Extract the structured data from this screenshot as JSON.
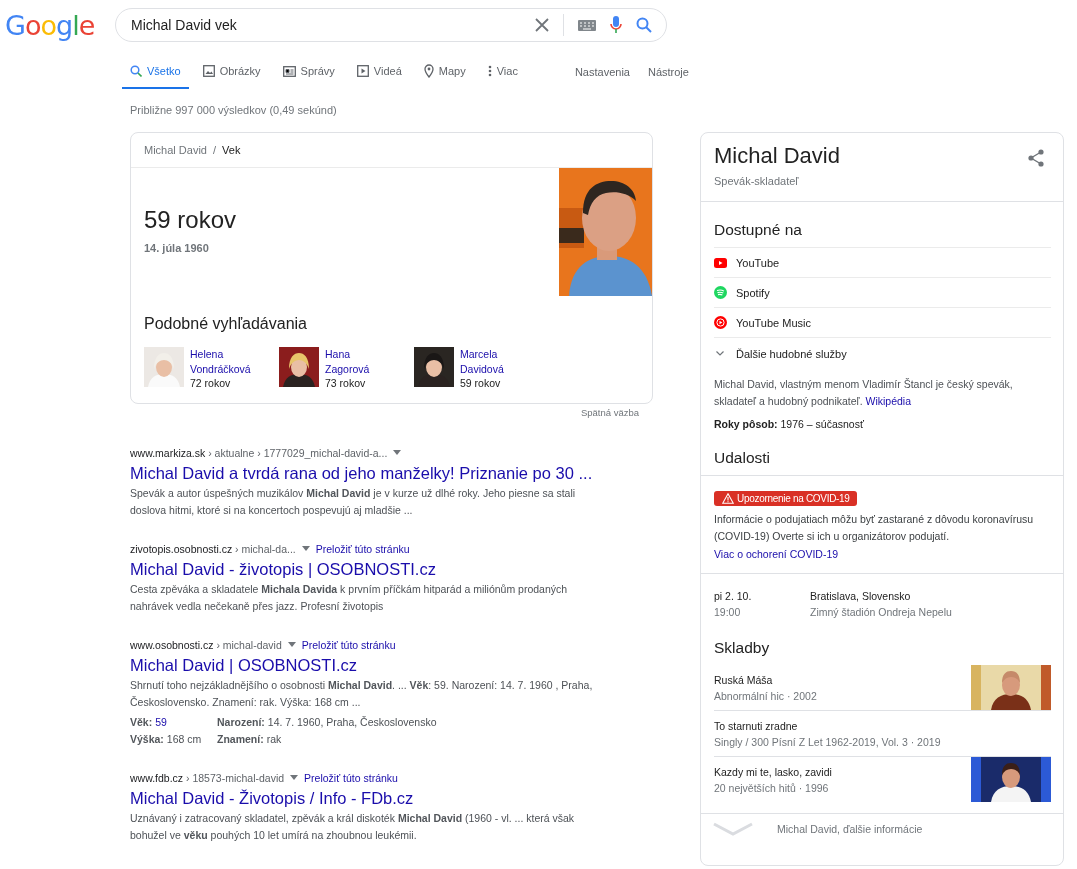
{
  "logo": "Google",
  "search": {
    "value": "Michal David vek"
  },
  "tabs": [
    {
      "label": "Všetko",
      "kind": "search",
      "selected": true
    },
    {
      "label": "Obrázky",
      "kind": "images",
      "selected": false
    },
    {
      "label": "Správy",
      "kind": "news",
      "selected": false
    },
    {
      "label": "Videá",
      "kind": "video",
      "selected": false
    },
    {
      "label": "Mapy",
      "kind": "maps",
      "selected": false
    },
    {
      "label": "Viac",
      "kind": "more",
      "selected": false
    }
  ],
  "tools": [
    "Nastavenia",
    "Nástroje"
  ],
  "result_stats": "Približne 997 000 výsledkov (0,49 sekúnd)",
  "age_card": {
    "breadcrumb": [
      "Michal David",
      "Vek"
    ],
    "breadcrumb_separator": "/",
    "age": "59 rokov",
    "birth_date": "14. júla 1960",
    "similar_title": "Podobné vyhľadávania",
    "similar": [
      {
        "name": "Helena Vondráčková",
        "age": "72 rokov"
      },
      {
        "name": "Hana Zagorová",
        "age": "73 rokov"
      },
      {
        "name": "Marcela Davidová",
        "age": "59 rokov"
      }
    ],
    "feedback": "Spätná väzba"
  },
  "results": [
    {
      "domain": "www.markiza.sk",
      "path": "› aktualne › 1777029_michal-david-a...",
      "title": "Michal David a tvrdá rana od jeho manželky! Priznanie po 30 ...",
      "snippet": "Spevák a autor úspešných muzikálov **Michal David** je v kurze už dlhé roky. Jeho piesne sa stali doslova hitmi, ktoré si na koncertoch pospevujú aj mladšie ..."
    },
    {
      "domain": "zivotopis.osobnosti.cz",
      "path": "› michal-da...",
      "translate": "Preložiť túto stránku",
      "title": "Michal David - životopis | OSOBNOSTI.cz",
      "snippet": "Cesta zpěváka a skladatele **Michala Davida** k prvním příčkám hitparád a miliónům prodaných nahrávek vedla nečekaně přes jazz. Profesní životopis"
    },
    {
      "domain": "www.osobnosti.cz",
      "path": "› michal-david",
      "translate": "Preložiť túto stránku",
      "title": "Michal David | OSOBNOSTI.cz",
      "snippet": "Shrnutí toho nejzákladnějšího o osobnosti **Michal David**. ... **Věk**: 59. Narození: 14. 7. 1960 , Praha, Československo. Znamení: rak. Výška: 168 cm ...",
      "facts": [
        {
          "label": "Věk:",
          "value": "59",
          "link": true
        },
        {
          "label": "Narození:",
          "value": "14. 7. 1960, Praha, Československo",
          "link": false
        },
        {
          "label": "Výška:",
          "value": "168 cm",
          "link": false
        },
        {
          "label": "Znamení:",
          "value": "rak",
          "link": false
        }
      ]
    },
    {
      "domain": "www.fdb.cz",
      "path": "› 18573-michal-david",
      "translate": "Preložiť túto stránku",
      "title": "Michal David - Životopis / Info - FDb.cz",
      "snippet": "Uznávaný i zatracovaný skladatel, zpěvák a král diskoték **Michal David** (1960 - vl. ... která však bohužel ve **věku** pouhých 10 let umírá na zhoubnou leukémii."
    }
  ],
  "panel": {
    "title": "Michal David",
    "subtitle": "Spevák-skladateľ",
    "available_title": "Dostupné na",
    "services": [
      {
        "name": "YouTube",
        "kind": "youtube"
      },
      {
        "name": "Spotify",
        "kind": "spotify"
      },
      {
        "name": "YouTube Music",
        "kind": "ytmusic"
      }
    ],
    "more_services": "Ďalšie hudobné služby",
    "description": "Michal David, vlastným menom Vladimír Štancl je český spevák, skladateľ a hudobný podnikateľ.",
    "description_link": "Wikipédia",
    "active_years": "**Roky pôsob:** 1976 – súčasnosť",
    "events_title": "Udalosti",
    "covid_badge": "Upozornenie na COVID-19",
    "covid_text": "Informácie o podujatiach môžu byť zastarané z dôvodu koronavírusu (COVID-19) Overte si ich u organizátorov podujatí.",
    "covid_link": "Viac o ochorení COVID-19",
    "event": {
      "date": "pi 2. 10.",
      "time": "19:00",
      "city": "Bratislava, Slovensko",
      "venue": "Zimný štadión Ondreja Nepelu"
    },
    "songs_title": "Skladby",
    "songs": [
      {
        "title": "Ruská Máša",
        "meta": "Abnormální hic · 2002",
        "kind": "picture"
      },
      {
        "title": "To starnuti zradne",
        "meta": "Singly / 300 Písní Z Let 1962-2019, Vol. 3 · 2019"
      },
      {
        "title": "Kazdy mi te, lasko, zavidi",
        "meta": "20 největších hitů · 1996",
        "kind": "picture"
      }
    ],
    "footer": "Michal David, ďalšie informácie"
  }
}
